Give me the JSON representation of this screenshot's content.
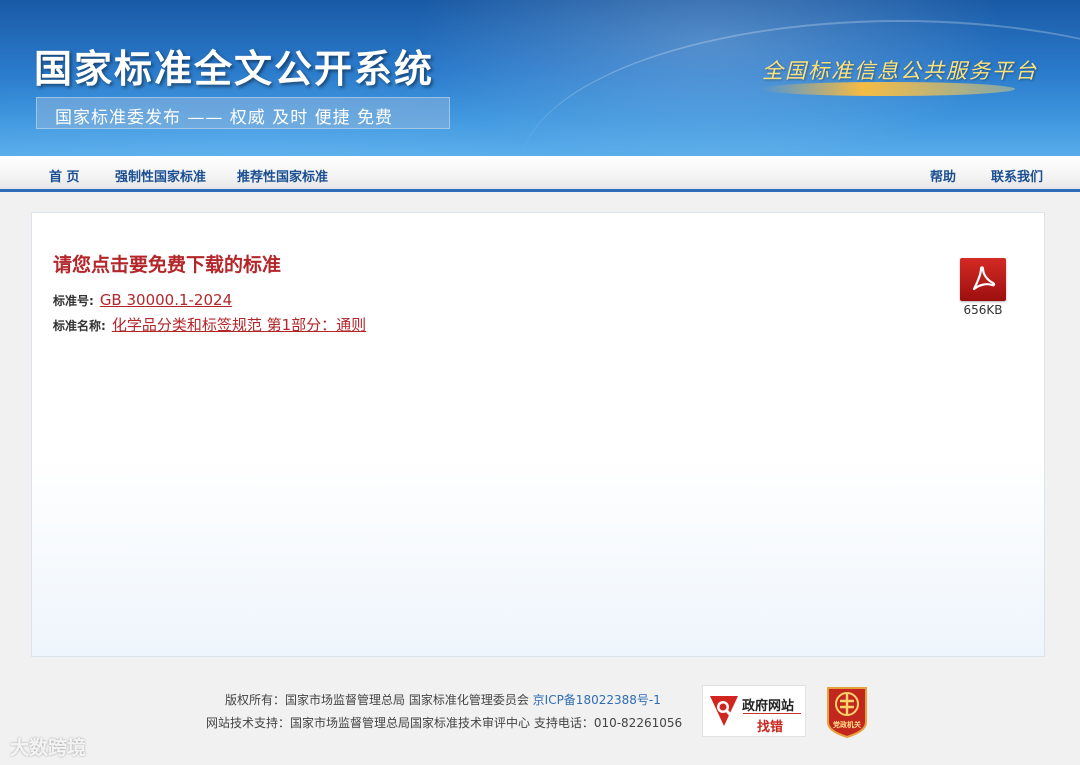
{
  "header": {
    "site_title": "国家标准全文公开系统",
    "slogan": "国家标准委发布 —— 权威 及时 便捷 免费",
    "platform": "全国标准信息公共服务平台"
  },
  "nav": {
    "home": "首 页",
    "mandatory": "强制性国家标准",
    "recommended": "推荐性国家标准",
    "help": "帮助",
    "contact": "联系我们"
  },
  "main": {
    "heading": "请您点击要免费下载的标准",
    "standard_no_label": "标准号:",
    "standard_no": "GB 30000.1-2024",
    "standard_name_label": "标准名称:",
    "standard_name": "化学品分类和标签规范 第1部分：通则",
    "file_icon": "pdf-icon",
    "file_size": "656KB"
  },
  "footer": {
    "copyright_prefix": "版权所有：国家市场监督管理总局 国家标准化管理委员会",
    "icp": "京ICP备18022388号-1",
    "support": "网站技术支持：国家市场监督管理总局国家标准技术审评中心 支持电话：010-82261056",
    "gov_badge_line1": "政府网站",
    "gov_badge_line2": "找错",
    "party_badge_text": "党政机关"
  },
  "watermark": "大数跨境",
  "colors": {
    "accent_red": "#b3262a",
    "nav_blue": "#1b4f92",
    "banner_blue": "#2a7acb"
  }
}
